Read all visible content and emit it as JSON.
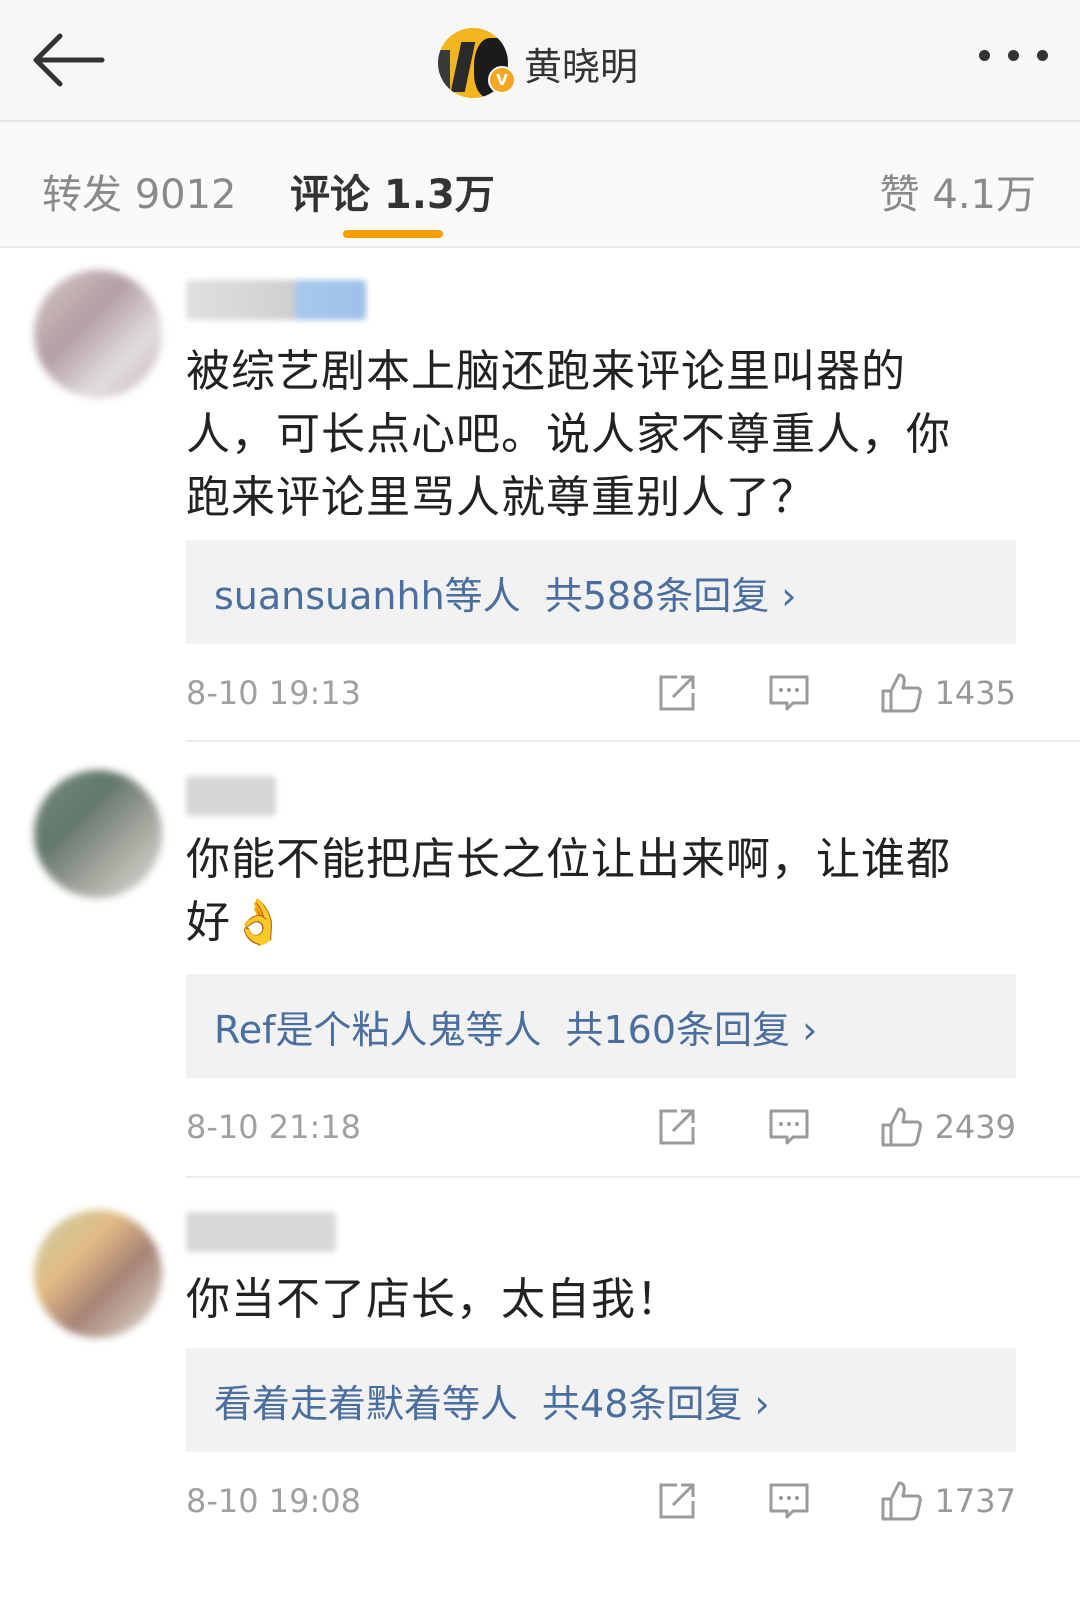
{
  "header": {
    "username": "黄晓明",
    "verified_badge": "V"
  },
  "tabs": {
    "repost": "转发 9012",
    "comment": "评论 1.3万",
    "like": "赞 4.1万"
  },
  "comments": [
    {
      "text_lines": [
        "被综艺剧本上脑还跑来评论里叫器的",
        "人，可长点心吧。说人家不尊重人，你",
        "跑来评论里骂人就尊重别人了？"
      ],
      "reply_users": "suansuanhh等人",
      "reply_count": "共588条回复 ›",
      "time": "8-10 19:13",
      "likes": "1435"
    },
    {
      "text_lines": [
        "你能不能把店长之位让出来啊，让谁都",
        "好👌"
      ],
      "reply_users": "Ref是个粘人鬼等人",
      "reply_count": "共160条回复 ›",
      "time": "8-10 21:18",
      "likes": "2439"
    },
    {
      "text_lines": [
        "你当不了店长，太自我！"
      ],
      "reply_users": "看着走着默着等人",
      "reply_count": "共48条回复 ›",
      "time": "8-10 19:08",
      "likes": "1737"
    }
  ],
  "icons": {
    "back": "arrow-left-icon",
    "more": "more-dots-icon",
    "share": "share-icon",
    "reply": "comment-icon",
    "like": "thumbs-up-icon"
  },
  "colors": {
    "accent": "#f5a000",
    "link": "#4a6e9d",
    "badge": "#f5a623"
  }
}
